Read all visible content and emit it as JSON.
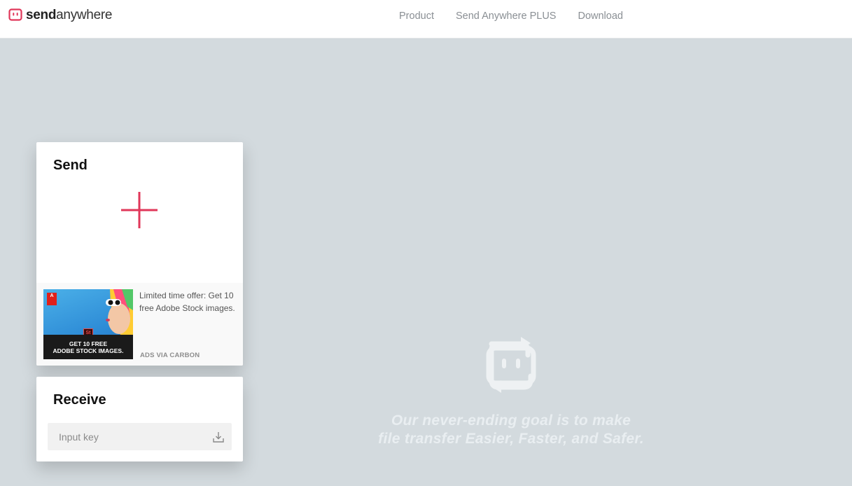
{
  "header": {
    "logo": {
      "bold": "send",
      "regular": "anywhere"
    },
    "nav": [
      {
        "label": "Product"
      },
      {
        "label": "Send Anywhere PLUS"
      },
      {
        "label": "Download"
      }
    ]
  },
  "send": {
    "title": "Send",
    "add_icon": "plus-icon",
    "ad": {
      "image_text_line1": "GET 10 FREE",
      "image_text_line2": "ADOBE STOCK IMAGES.",
      "copy": "Limited time offer: Get 10 free Adobe Stock images.",
      "via": "ADS VIA CARBON"
    }
  },
  "receive": {
    "title": "Receive",
    "input_placeholder": "Input key",
    "input_value": "",
    "action_icon": "download-icon"
  },
  "hero": {
    "line1": "Our never-ending goal is to make",
    "line2": "file transfer Easier, Faster, and Safer."
  },
  "colors": {
    "brand": "#e0375a",
    "background": "#d3dade",
    "hero_text": "#e9eef1"
  }
}
